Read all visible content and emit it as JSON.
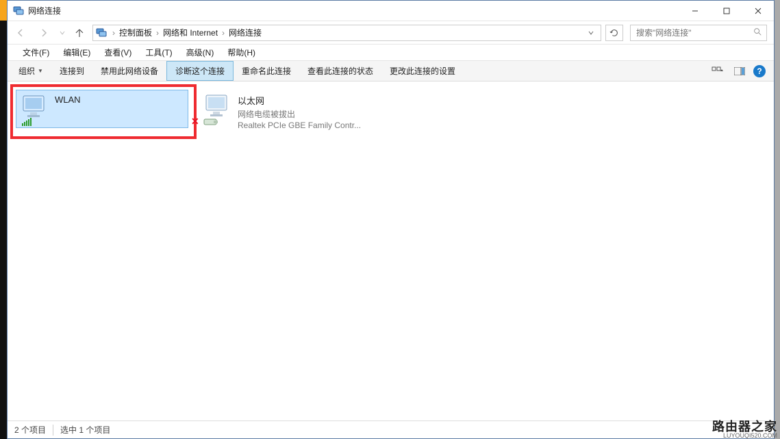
{
  "window": {
    "title": "网络连接"
  },
  "breadcrumb": {
    "items": [
      "控制面板",
      "网络和 Internet",
      "网络连接"
    ]
  },
  "search": {
    "placeholder": "搜索\"网络连接\""
  },
  "menubar": {
    "file": "文件(F)",
    "edit": "编辑(E)",
    "view": "查看(V)",
    "tools": "工具(T)",
    "advanced": "高级(N)",
    "help": "帮助(H)"
  },
  "toolbar": {
    "organize": "组织",
    "connect_to": "连接到",
    "disable_device": "禁用此网络设备",
    "diagnose": "诊断这个连接",
    "rename": "重命名此连接",
    "view_status": "查看此连接的状态",
    "change_settings": "更改此连接的设置"
  },
  "connections": {
    "wlan": {
      "name": "WLAN",
      "status": "",
      "detail": ""
    },
    "ethernet": {
      "name": "以太网",
      "status": "网络电缆被拔出",
      "detail": "Realtek PCIe GBE Family Contr..."
    }
  },
  "statusbar": {
    "total": "2 个项目",
    "selected": "选中 1 个项目"
  },
  "watermark": {
    "line1": "路由器之家",
    "line2": "LUYOUQI520.COM"
  }
}
